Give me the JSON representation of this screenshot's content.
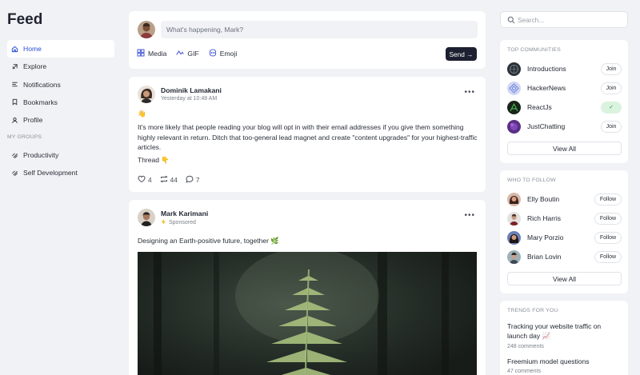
{
  "app": {
    "title": "Feed"
  },
  "sidebar": {
    "nav": [
      {
        "label": "Home",
        "icon": "home-icon",
        "active": true
      },
      {
        "label": "Explore",
        "icon": "explore-icon",
        "active": false
      },
      {
        "label": "Notifications",
        "icon": "notifications-icon",
        "active": false
      },
      {
        "label": "Bookmarks",
        "icon": "bookmark-icon",
        "active": false
      },
      {
        "label": "Profile",
        "icon": "user-icon",
        "active": false
      }
    ],
    "groups_title": "MY GROUPS",
    "groups": [
      {
        "label": "Productivity",
        "icon": "group-icon"
      },
      {
        "label": "Self Development",
        "icon": "group-icon"
      }
    ]
  },
  "composer": {
    "placeholder": "What's happening, Mark?",
    "tools": {
      "media": "Media",
      "gif": "GIF",
      "emoji": "Emoji"
    },
    "send_label": "Send →"
  },
  "posts": [
    {
      "author": "Dominik Lamakani",
      "meta": "Yesterday at 10:48 AM",
      "emoji": "👋",
      "body": "It's more likely that people reading your blog will opt in with their email addresses if you give them something highly relevant in return. Ditch that too-general lead magnet and create \"content upgrades\" for your highest-traffic articles.",
      "thread": "Thread 👇",
      "likes": "4",
      "reposts": "44",
      "comments": "7"
    },
    {
      "author": "Mark Karimani",
      "meta": "Sponsored",
      "body": "Designing an Earth-positive future, together 🌿"
    }
  ],
  "search": {
    "placeholder": "Search..."
  },
  "communities": {
    "title": "TOP COMMUNITIES",
    "items": [
      {
        "name": "Introductions",
        "action": "Join"
      },
      {
        "name": "HackerNews",
        "action": "Join"
      },
      {
        "name": "ReactJs",
        "action": "✓"
      },
      {
        "name": "JustChatting",
        "action": "Join"
      }
    ],
    "view_all": "View All"
  },
  "follow": {
    "title": "WHO TO FOLLOW",
    "items": [
      {
        "name": "Elly Boutin",
        "action": "Follow"
      },
      {
        "name": "Rich Harris",
        "action": "Follow"
      },
      {
        "name": "Mary Porzio",
        "action": "Follow"
      },
      {
        "name": "Brian Lovin",
        "action": "Follow"
      }
    ],
    "view_all": "View All"
  },
  "trends": {
    "title": "TRENDS FOR YOU",
    "items": [
      {
        "title": "Tracking your website traffic on launch day 📈",
        "meta": "248 comments"
      },
      {
        "title": "Freemium model questions",
        "meta": "47 comments"
      }
    ]
  },
  "colors": {
    "accent": "#2b4dd6",
    "dark": "#1c2030",
    "background": "#f1f2f5",
    "joined": "#d9f3df"
  }
}
